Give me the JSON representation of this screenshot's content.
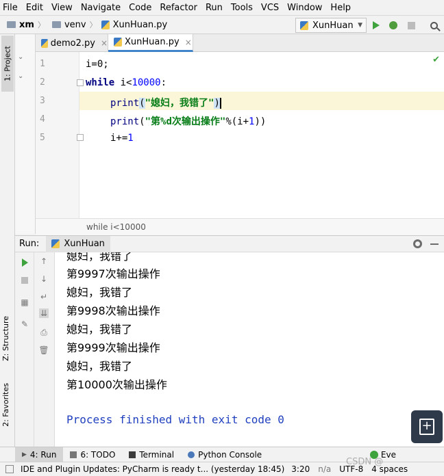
{
  "menu": [
    "File",
    "Edit",
    "View",
    "Navigate",
    "Code",
    "Refactor",
    "Run",
    "Tools",
    "VCS",
    "Window",
    "Help"
  ],
  "breadcrumb": {
    "project": "xm",
    "folder": "venv",
    "file": "XunHuan.py"
  },
  "run_config": "XunHuan",
  "side_tabs": {
    "project": "1: Project",
    "structure": "Z: Structure",
    "favorites": "2: Favorites"
  },
  "editor_tabs": [
    {
      "label": "demo2.py",
      "close": "×"
    },
    {
      "label": "XunHuan.py",
      "close": "×"
    }
  ],
  "line_numbers": [
    "1",
    "2",
    "3",
    "4",
    "5"
  ],
  "code": {
    "l1": "i=0;",
    "l2_kw": "while",
    "l2_rest": " i<",
    "l2_num": "10000",
    "l2_end": ":",
    "l3_fn": "print",
    "l3_open": "(",
    "l3_str": "\"媳妇，我错了\"",
    "l3_close": ")",
    "l4_fn": "print",
    "l4_open": "(",
    "l4_str": "\"第%d次输出操作\"",
    "l4_rest": "%(i+",
    "l4_num": "1",
    "l4_close": "))",
    "l5": "i+=",
    "l5_num": "1"
  },
  "editor_breadcrumb": "while i<10000",
  "run_panel": {
    "label": "Run:",
    "tab": "XunHuan"
  },
  "console_lines": [
    "媳妇，我错了",
    "第9997次输出操作",
    "媳妇，我错了",
    "第9998次输出操作",
    "媳妇，我错了",
    "第9999次输出操作",
    "媳妇，我错了",
    "第10000次输出操作"
  ],
  "console_finish": "Process finished with exit code 0",
  "bottom_tabs": [
    "4: Run",
    "6: TODO",
    "Terminal",
    "Python Console"
  ],
  "event_log": "Eve",
  "status": {
    "message": "IDE and Plugin Updates: PyCharm is ready t... (yesterday 18:45)",
    "position": "3:20",
    "line_sep": "n/a",
    "encoding": "UTF-8",
    "indent": "4 spaces"
  },
  "watermark": "CSDN @",
  "colors": {
    "accent": "#4083c9",
    "run_green": "#3ea33c",
    "string_green": "#067d17",
    "keyword": "#000080",
    "console_blue": "#1f3fbf"
  }
}
